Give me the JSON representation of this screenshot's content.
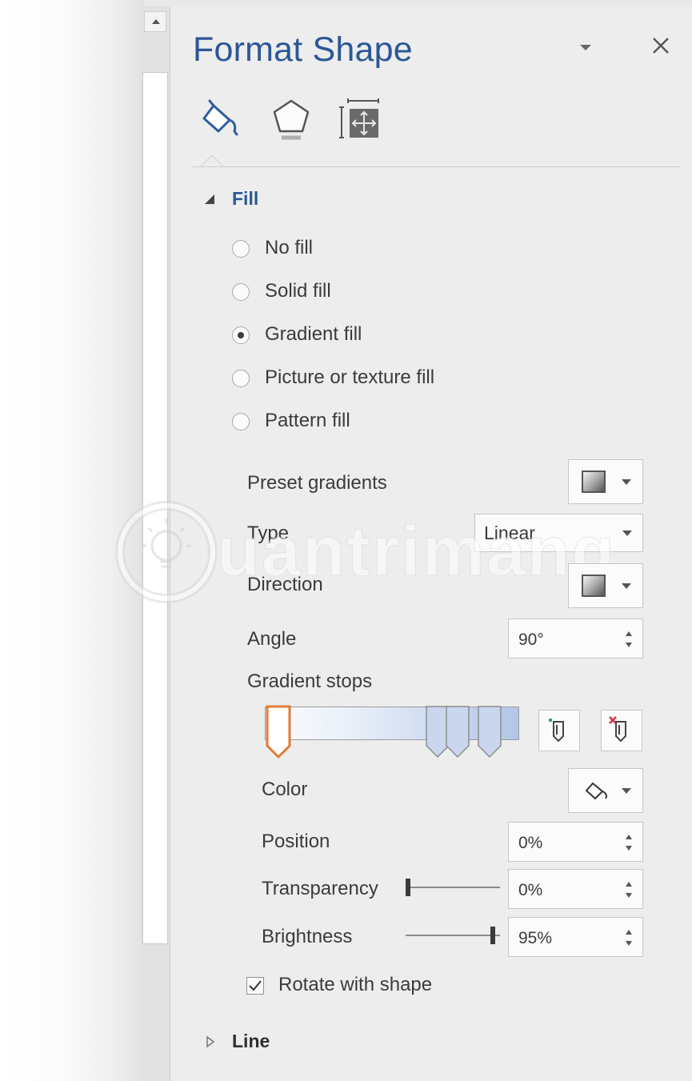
{
  "pane": {
    "title": "Format Shape",
    "tabs": [
      {
        "icon": "fill-line-icon",
        "active": true
      },
      {
        "icon": "effects-pentagon-icon",
        "active": false
      },
      {
        "icon": "size-properties-icon",
        "active": false
      }
    ]
  },
  "fill": {
    "heading": "Fill",
    "options": [
      {
        "label": "No fill",
        "checked": false
      },
      {
        "label": "Solid fill",
        "checked": false
      },
      {
        "label": "Gradient fill",
        "checked": true
      },
      {
        "label": "Picture or texture fill",
        "checked": false
      },
      {
        "label": "Pattern fill",
        "checked": false
      }
    ],
    "preset_label": "Preset gradients",
    "type_label": "Type",
    "type_value": "Linear",
    "direction_label": "Direction",
    "angle_label": "Angle",
    "angle_value": "90°",
    "stops_label": "Gradient stops",
    "stop_positions": [
      0,
      0.7,
      0.79,
      0.93
    ],
    "selected_stop": 0,
    "color_label": "Color",
    "position_label": "Position",
    "position_value": "0%",
    "transparency_label": "Transparency",
    "transparency_value": "0%",
    "transparency_level": 0,
    "brightness_label": "Brightness",
    "brightness_value": "95%",
    "brightness_level": 0.95,
    "rotate_label": "Rotate with shape",
    "rotate_checked": true
  },
  "line": {
    "heading": "Line"
  },
  "watermark": {
    "text": "uantrimang"
  },
  "colors": {
    "title_blue": "#2b5797",
    "accent_blue": "#2e5d9f",
    "stop_selected": "#e07b39"
  }
}
